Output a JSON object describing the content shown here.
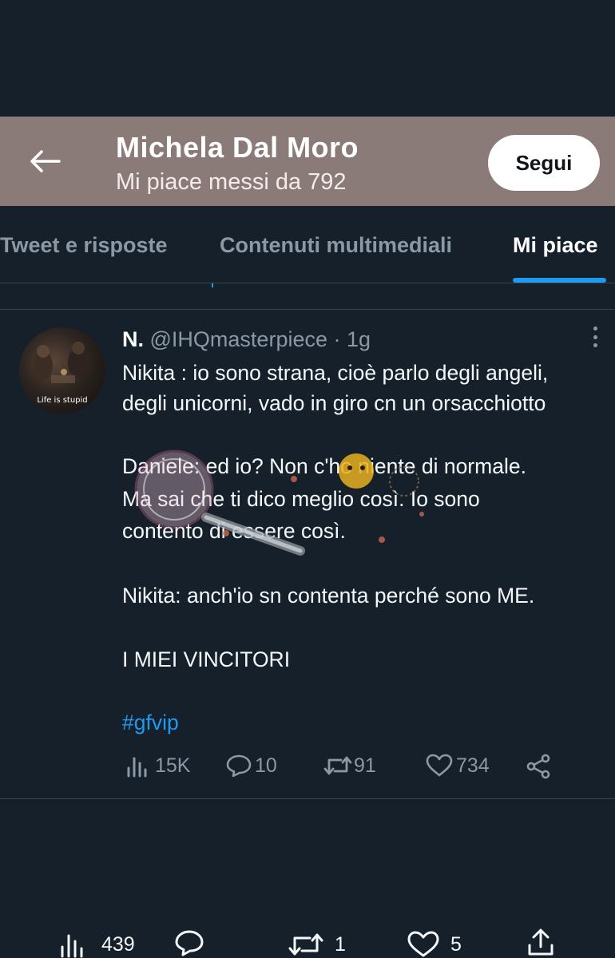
{
  "header": {
    "title": "Michela Dal Moro",
    "subtitle": "Mi piace messi da 792",
    "follow_label": "Segui",
    "bg_color": "#8b7b78"
  },
  "tabs": [
    {
      "label": "Tweet e risposte",
      "active": false
    },
    {
      "label": "Contenuti multimediali",
      "active": false
    },
    {
      "label": "Mi piace",
      "active": true
    }
  ],
  "tweet": {
    "avatar_caption": "Life is stupid",
    "name": "N.",
    "handle": "@IHQmasterpiece",
    "dot": "·",
    "time": "1g",
    "lines": [
      "Nikita : io sono strana, cioè parlo degli angeli,",
      "degli unicorni, vado in giro cn un orsacchiotto",
      "Daniele: ed io? Non c'ho niente di normale.",
      "Ma sai che ti dico meglio così. Io sono",
      "contento di essere così.",
      "Nikita: anch'io sn contenta perché sono ME.",
      "I MIEI VINCITORI"
    ],
    "hashtag": "#gfvip",
    "actions": {
      "views": "15K",
      "replies": "10",
      "retweets": "91",
      "likes": "734"
    }
  },
  "bottom_bar": {
    "views": "439",
    "retweets": "1",
    "likes": "5"
  },
  "colors": {
    "background": "#15202b",
    "accent": "#1d9bf0",
    "muted": "#8b98a5",
    "divider": "#38444d"
  }
}
